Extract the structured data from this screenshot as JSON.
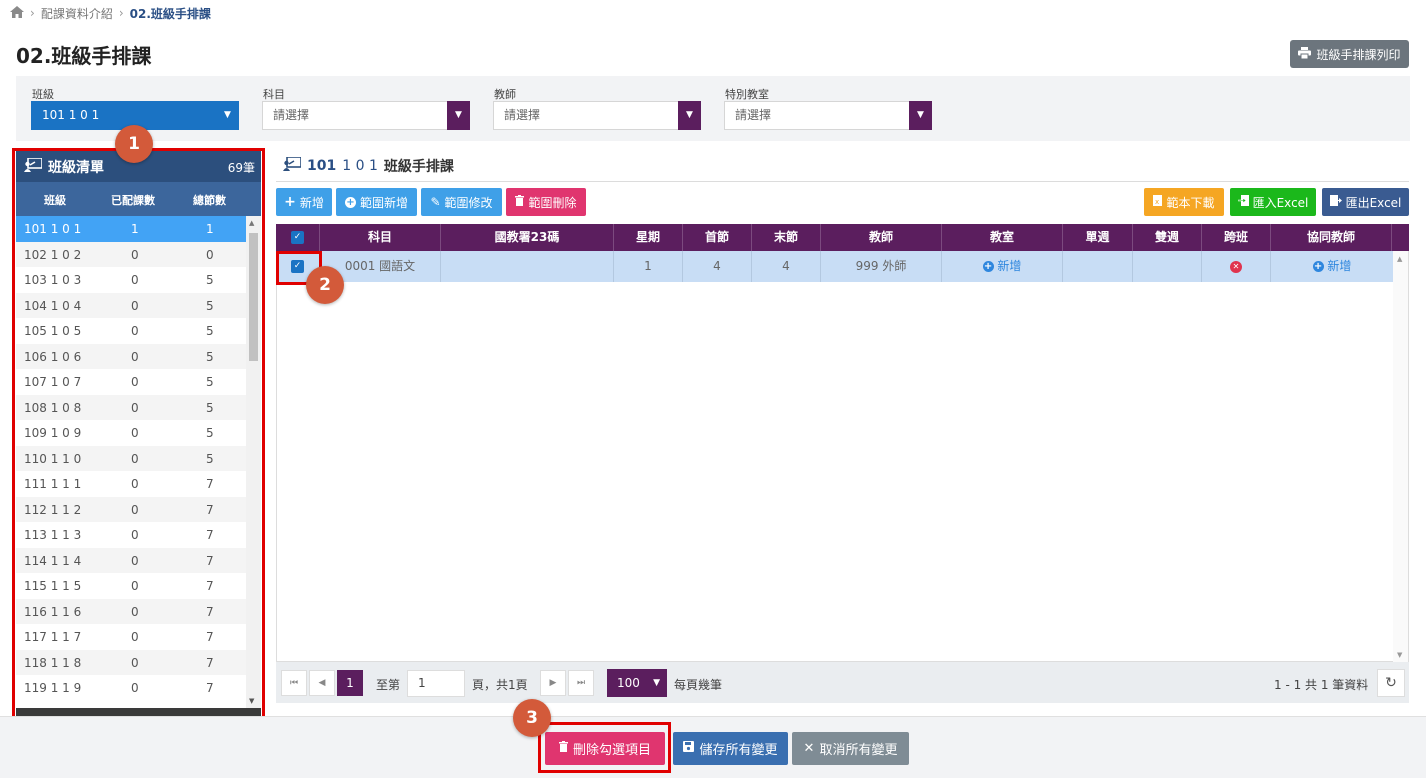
{
  "breadcrumb": {
    "parent": "配課資料介紹",
    "current": "02.班級手排課"
  },
  "page": {
    "title": "02.班級手排課",
    "print_label": "班級手排課列印"
  },
  "filters": {
    "class_label": "班級",
    "class_value": "101 1 0 1",
    "subject_label": "科目",
    "subject_value": "請選擇",
    "teacher_label": "教師",
    "teacher_value": "請選擇",
    "room_label": "特別教室",
    "room_value": "請選擇"
  },
  "class_list": {
    "title": "班級清單",
    "count": "69筆",
    "columns": [
      "班級",
      "已配課數",
      "總節數"
    ],
    "rows": [
      {
        "name": "101 1 0 1",
        "assigned": "1",
        "total": "1"
      },
      {
        "name": "102 1 0 2",
        "assigned": "0",
        "total": "0"
      },
      {
        "name": "103 1 0 3",
        "assigned": "0",
        "total": "5"
      },
      {
        "name": "104 1 0 4",
        "assigned": "0",
        "total": "5"
      },
      {
        "name": "105 1 0 5",
        "assigned": "0",
        "total": "5"
      },
      {
        "name": "106 1 0 6",
        "assigned": "0",
        "total": "5"
      },
      {
        "name": "107 1 0 7",
        "assigned": "0",
        "total": "5"
      },
      {
        "name": "108 1 0 8",
        "assigned": "0",
        "total": "5"
      },
      {
        "name": "109 1 0 9",
        "assigned": "0",
        "total": "5"
      },
      {
        "name": "110 1 1 0",
        "assigned": "0",
        "total": "5"
      },
      {
        "name": "111 1 1 1",
        "assigned": "0",
        "total": "7"
      },
      {
        "name": "112 1 1 2",
        "assigned": "0",
        "total": "7"
      },
      {
        "name": "113 1 1 3",
        "assigned": "0",
        "total": "7"
      },
      {
        "name": "114 1 1 4",
        "assigned": "0",
        "total": "7"
      },
      {
        "name": "115 1 1 5",
        "assigned": "0",
        "total": "7"
      },
      {
        "name": "116 1 1 6",
        "assigned": "0",
        "total": "7"
      },
      {
        "name": "117 1 1 7",
        "assigned": "0",
        "total": "7"
      },
      {
        "name": "118 1 1 8",
        "assigned": "0",
        "total": "7"
      },
      {
        "name": "119 1 1 9",
        "assigned": "0",
        "total": "7"
      }
    ]
  },
  "schedule": {
    "title_code": "101",
    "title_class": "1 0 1",
    "title_text": "班級手排課",
    "buttons": {
      "add": "新增",
      "range_add": "範圍新增",
      "range_edit": "範圍修改",
      "range_delete": "範圍刪除",
      "template": "範本下載",
      "import": "匯入Excel",
      "export": "匯出Excel"
    },
    "columns": [
      "科目",
      "國教署23碼",
      "星期",
      "首節",
      "末節",
      "教師",
      "教室",
      "單週",
      "雙週",
      "跨班",
      "協同教師"
    ],
    "row": {
      "subject": "0001 國語文",
      "code23": "",
      "weekday": "1",
      "first": "4",
      "last": "4",
      "teacher": "999 外師",
      "room": "新增",
      "single_week": "",
      "double_week": "",
      "co_teacher": "新增"
    },
    "pager": {
      "page": "1",
      "goto_label": "至第",
      "goto_value": "1",
      "page_total": "頁，共1頁",
      "page_size": "100",
      "page_size_label": "每頁幾筆",
      "summary": "1 - 1 共 1 筆資料"
    }
  },
  "annotations": [
    "1",
    "2",
    "3"
  ],
  "actions": {
    "delete_checked": "刪除勾選項目",
    "save_all": "儲存所有變更",
    "cancel_all": "取消所有變更"
  },
  "colors": {
    "purple": "#5b1e5e",
    "navy": "#2c4f7d",
    "blue": "#1a73c4",
    "pink": "#e0356f",
    "highlight": "#e00000"
  }
}
